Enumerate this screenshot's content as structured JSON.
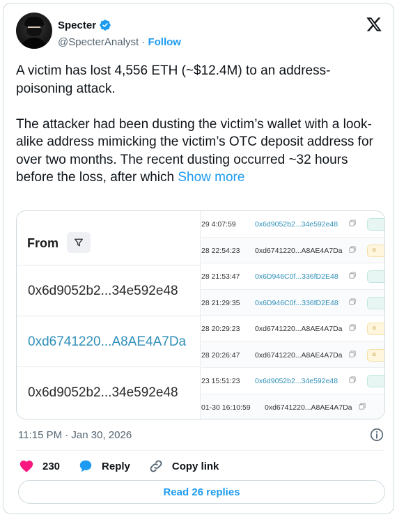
{
  "tweet": {
    "author_name": "Specter",
    "handle": "@SpecterAnalyst",
    "separator": " · ",
    "follow_label": "Follow",
    "text_main": "A victim has lost 4,556 ETH (~$12.4M) to an address-poisoning attack.\n\nThe attacker had been dusting the victim’s wallet with a look-alike address mimicking the victim’s OTC deposit address for over two months. The recent dusting occurred ~32 hours before the loss, after which ",
    "show_more": "Show more",
    "timestamp": "11:15 PM · Jan 30, 2026",
    "likes": "230",
    "reply_label": "Reply",
    "copy_link_label": "Copy link",
    "read_replies_label": "Read 26 replies"
  },
  "colors": {
    "accent": "#1d9bf0",
    "like": "#f91880",
    "text": "#0f1419",
    "muted": "#536471"
  },
  "icons": {
    "verified": "verified-badge-icon",
    "platform": "x-logo-icon",
    "filter": "filter-icon",
    "copy": "copy-icon",
    "info": "info-icon",
    "heart": "heart-icon",
    "reply": "reply-bubble-icon",
    "link": "link-icon"
  },
  "media": {
    "from_header": "From",
    "from_rows": [
      {
        "address": "0x6d9052b2...34e592e48",
        "style": "dark"
      },
      {
        "address": "0xd6741220...A8AE4A7Da",
        "style": "blue"
      },
      {
        "address": "0x6d9052b2...34e592e48",
        "style": "dark"
      }
    ],
    "tx_rows": [
      {
        "time": "29 4:07:59",
        "address": "0x6d9052b2...34e592e48",
        "style": "blue",
        "tag": "green",
        "tag_text": ""
      },
      {
        "time": "28 22:54:23",
        "address": "0xd6741220...A8AE4A7Da",
        "style": "dark",
        "tag": "yellow",
        "tag_text": "o"
      },
      {
        "time": "28 21:53:47",
        "address": "0x6D946C0f...336fD2E48",
        "style": "blue",
        "tag": "green",
        "tag_text": ""
      },
      {
        "time": "28 21:29:35",
        "address": "0x6D946C0f...336fD2E48",
        "style": "blue",
        "tag": "green",
        "tag_text": ""
      },
      {
        "time": "28 20:29:23",
        "address": "0xd6741220...A8AE4A7Da",
        "style": "dark",
        "tag": "yellow",
        "tag_text": "o"
      },
      {
        "time": "28 20:26:47",
        "address": "0xd6741220...A8AE4A7Da",
        "style": "dark",
        "tag": "yellow",
        "tag_text": "o"
      },
      {
        "time": "23 15:51:23",
        "address": "0x6d9052b2...34e592e48",
        "style": "blue",
        "tag": "green",
        "tag_text": ""
      },
      {
        "time": "01-30 16:10:59",
        "address": "0xd6741220...A8AE4A7Da",
        "style": "dark",
        "tag": "",
        "tag_text": ""
      }
    ]
  }
}
